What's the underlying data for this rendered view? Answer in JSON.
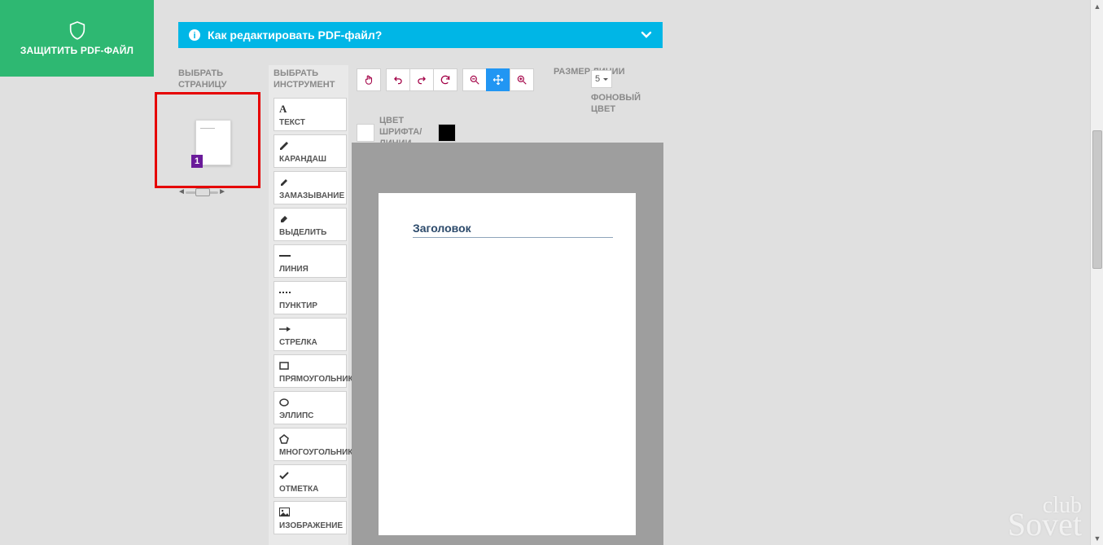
{
  "protect": {
    "label": "ЗАЩИТИТЬ PDF-ФАЙЛ"
  },
  "help_bar": {
    "text": "Как редактировать PDF-файл?"
  },
  "page_selector": {
    "label": "ВЫБРАТЬ СТРАНИЦУ",
    "current": "1"
  },
  "tool_selector": {
    "label": "ВЫБРАТЬ ИНСТРУМЕНТ",
    "items": [
      {
        "id": "text",
        "label": "ТЕКСТ"
      },
      {
        "id": "pencil",
        "label": "КАРАНДАШ"
      },
      {
        "id": "smudge",
        "label": "ЗАМАЗЫВАНИЕ"
      },
      {
        "id": "highlight",
        "label": "ВЫДЕЛИТЬ"
      },
      {
        "id": "line",
        "label": "ЛИНИЯ"
      },
      {
        "id": "dashed",
        "label": "ПУНКТИР"
      },
      {
        "id": "arrow",
        "label": "СТРЕЛКА"
      },
      {
        "id": "rect",
        "label": "ПРЯМОУГОЛЬНИК"
      },
      {
        "id": "ellipse",
        "label": "ЭЛЛИПС"
      },
      {
        "id": "polygon",
        "label": "МНОГОУГОЛЬНИК"
      },
      {
        "id": "check",
        "label": "ОТМЕТКА"
      },
      {
        "id": "image",
        "label": "ИЗОБРАЖЕНИЕ"
      }
    ]
  },
  "toolbar": {
    "size_label": "РАЗМЕР ЛИНИИ",
    "size_value": "5",
    "bg_label": "ФОНОВЫЙ ЦВЕТ",
    "font_color_label": "ЦВЕТ ШРИФТА/ЛИНИИ",
    "font_color": "#ffffff",
    "bg_color": "#000000"
  },
  "document": {
    "title": "Заголовок"
  },
  "watermark": {
    "line1": "club",
    "line2": "Sovet"
  }
}
